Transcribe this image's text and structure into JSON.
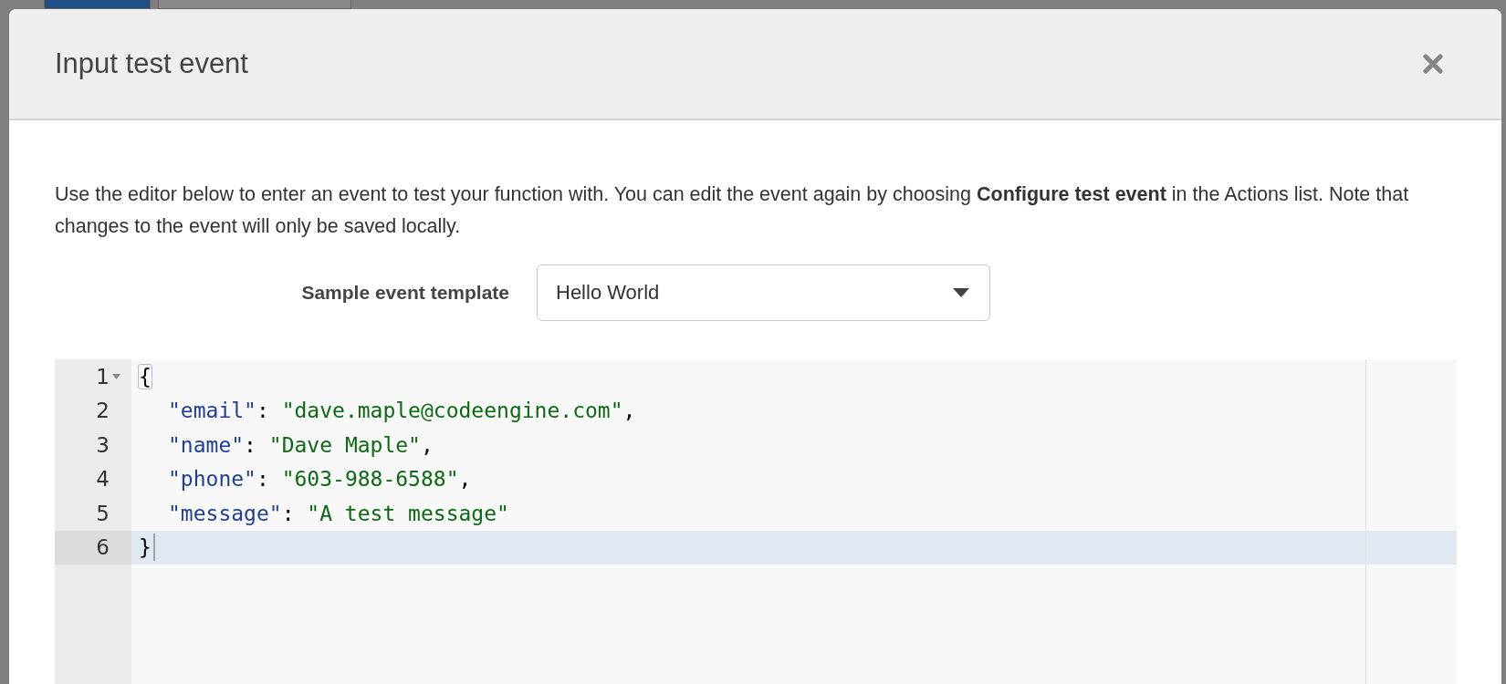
{
  "background_tabs": [
    {
      "selected": true
    },
    {
      "selected": false
    }
  ],
  "modal": {
    "title": "Input test event",
    "description": "Use the editor below to enter an event to test your function with. You can edit the event again by choosing **Configure test event** in the Actions list. Note that changes to the event will only be saved locally.",
    "template": {
      "label": "Sample event template",
      "value": "Hello World"
    },
    "editor": {
      "lines": [
        {
          "number": "1",
          "foldable": true,
          "active": false,
          "tokens": [
            {
              "kind": "bracket",
              "text": "{"
            }
          ]
        },
        {
          "number": "2",
          "foldable": false,
          "active": false,
          "tokens": [
            {
              "kind": "key",
              "text": "\"email\""
            },
            {
              "kind": "punct",
              "text": ": "
            },
            {
              "kind": "string",
              "text": "\"dave.maple@codeengine.com\""
            },
            {
              "kind": "punct",
              "text": ","
            }
          ]
        },
        {
          "number": "3",
          "foldable": false,
          "active": false,
          "tokens": [
            {
              "kind": "key",
              "text": "\"name\""
            },
            {
              "kind": "punct",
              "text": ": "
            },
            {
              "kind": "string",
              "text": "\"Dave Maple\""
            },
            {
              "kind": "punct",
              "text": ","
            }
          ]
        },
        {
          "number": "4",
          "foldable": false,
          "active": false,
          "tokens": [
            {
              "kind": "key",
              "text": "\"phone\""
            },
            {
              "kind": "punct",
              "text": ": "
            },
            {
              "kind": "string",
              "text": "\"603-988-6588\""
            },
            {
              "kind": "punct",
              "text": ","
            }
          ]
        },
        {
          "number": "5",
          "foldable": false,
          "active": false,
          "tokens": [
            {
              "kind": "key",
              "text": "\"message\""
            },
            {
              "kind": "punct",
              "text": ": "
            },
            {
              "kind": "string",
              "text": "\"A test message\""
            }
          ]
        },
        {
          "number": "6",
          "foldable": false,
          "active": true,
          "tokens": [
            {
              "kind": "punct",
              "text": "}"
            }
          ]
        }
      ]
    }
  }
}
